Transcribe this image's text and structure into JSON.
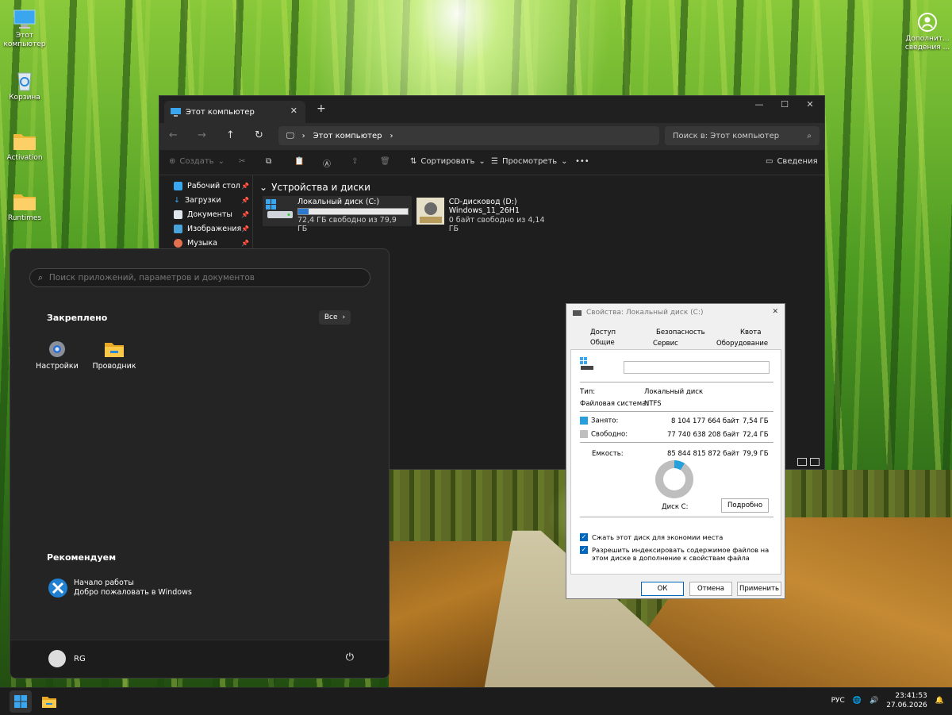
{
  "desktop": {
    "icons": [
      {
        "label": "Этот компьютер"
      },
      {
        "label": "Корзина"
      },
      {
        "label": "Activation"
      },
      {
        "label": "Runtimes"
      }
    ],
    "right_icon_label": "Дополнит... сведения ..."
  },
  "explorer": {
    "tab_title": "Этот компьютер",
    "address": "Этот компьютер",
    "search_placeholder": "Поиск в: Этот компьютер",
    "toolbar": {
      "create": "Создать",
      "sort": "Сортировать",
      "view": "Просмотреть",
      "more": "•••",
      "details": "Сведения"
    },
    "sidebar": [
      {
        "label": "Рабочий стол"
      },
      {
        "label": "Загрузки"
      },
      {
        "label": "Документы"
      },
      {
        "label": "Изображения"
      },
      {
        "label": "Музыка"
      }
    ],
    "section_title": "Устройства и диски",
    "drives": [
      {
        "name": "Локальный диск (C:)",
        "free": "72,4 ГБ свободно из 79,9 ГБ",
        "used_fraction": 0.094
      },
      {
        "name": "CD-дисковод (D:)",
        "label": "Windows_11_26H1",
        "free": "0 байт свободно из 4,14 ГБ"
      }
    ]
  },
  "start_menu": {
    "search_placeholder": "Поиск приложений, параметров и документов",
    "pinned_title": "Закреплено",
    "all_label": "Все",
    "pinned": [
      {
        "label": "Настройки"
      },
      {
        "label": "Проводник"
      }
    ],
    "recommended_title": "Рекомендуем",
    "recommended": {
      "title": "Начало работы",
      "subtitle": "Добро пожаловать в Windows"
    },
    "user": "RG"
  },
  "properties": {
    "title": "Свойства: Локальный диск (C:)",
    "tabs_top": [
      "Доступ",
      "Безопасность",
      "Квота"
    ],
    "tabs_bottom": [
      "Общие",
      "Сервис",
      "Оборудование"
    ],
    "name_value": "",
    "type_label": "Тип:",
    "type_value": "Локальный диск",
    "fs_label": "Файловая система:",
    "fs_value": "NTFS",
    "used_label": "Занято:",
    "used_bytes": "8 104 177 664 байт",
    "used_gb": "7,54 ГБ",
    "free_label": "Свободно:",
    "free_bytes": "77 740 638 208 байт",
    "free_gb": "72,4 ГБ",
    "capacity_label": "Емкость:",
    "capacity_bytes": "85 844 815 872 байт",
    "capacity_gb": "79,9 ГБ",
    "used_color": "#26a0da",
    "free_color": "#bebebe",
    "disk_label": "Диск C:",
    "details_button": "Подробно",
    "compress_label": "Сжать этот диск для экономии места",
    "index_label": "Разрешить индексировать содержимое файлов на этом диске в дополнение к свойствам файла",
    "ok": "ОК",
    "cancel": "Отмена",
    "apply": "Применить"
  },
  "taskbar": {
    "lang": "РУС",
    "time": "23:41:53",
    "date": "27.06.2026"
  }
}
